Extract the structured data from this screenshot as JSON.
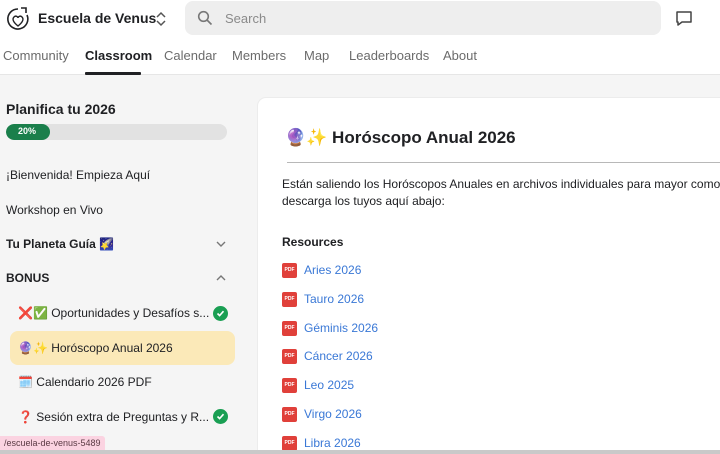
{
  "header": {
    "brand": "Escuela de Venus",
    "search_placeholder": "Search"
  },
  "nav": {
    "tabs": [
      {
        "label": "Community"
      },
      {
        "label": "Classroom"
      },
      {
        "label": "Calendar"
      },
      {
        "label": "Members"
      },
      {
        "label": "Map"
      },
      {
        "label": "Leaderboards"
      },
      {
        "label": "About"
      }
    ],
    "active_tab": "Classroom"
  },
  "sidebar": {
    "course_title": "Planifica tu 2026",
    "progress_label": "20%",
    "progress_value": 0.2,
    "items": [
      {
        "label": "¡Bienvenida! Empieza Aquí"
      },
      {
        "label": "Workshop en Vivo"
      },
      {
        "label": "Tu Planeta Guía 🌠",
        "state": "collapsed"
      },
      {
        "label": "BONUS",
        "state": "expanded"
      }
    ],
    "lessons": [
      {
        "label": "❌✅ Oportunidades y Desafíos s...",
        "completed": true
      },
      {
        "label": "🔮✨ Horóscopo Anual 2026",
        "active": true
      },
      {
        "label": "🗓️ Calendario 2026 PDF"
      },
      {
        "label": "❓ Sesión extra de Preguntas y R...",
        "completed": true
      }
    ]
  },
  "post": {
    "title": "🔮✨ Horóscopo Anual 2026",
    "body_line1": "Están saliendo los Horóscopos Anuales en archivos individuales para mayor comodidad,",
    "body_line2": "descarga los tuyos aquí abajo:",
    "resources_heading": "Resources",
    "resources": [
      {
        "label": "Aries 2026"
      },
      {
        "label": "Tauro 2026"
      },
      {
        "label": "Géminis 2026"
      },
      {
        "label": "Cáncer 2026"
      },
      {
        "label": "Leo 2025"
      },
      {
        "label": "Virgo 2026"
      },
      {
        "label": "Libra 2026"
      }
    ],
    "file_badge": "PDF"
  },
  "status_bar": {
    "url_chip": "/escuela-de-venus-5489"
  },
  "colors": {
    "accent_green": "#1a7f4b",
    "active_lesson_bg": "#fbe9b8",
    "link_blue": "#3a78d6",
    "pdf_red": "#e0403a"
  }
}
